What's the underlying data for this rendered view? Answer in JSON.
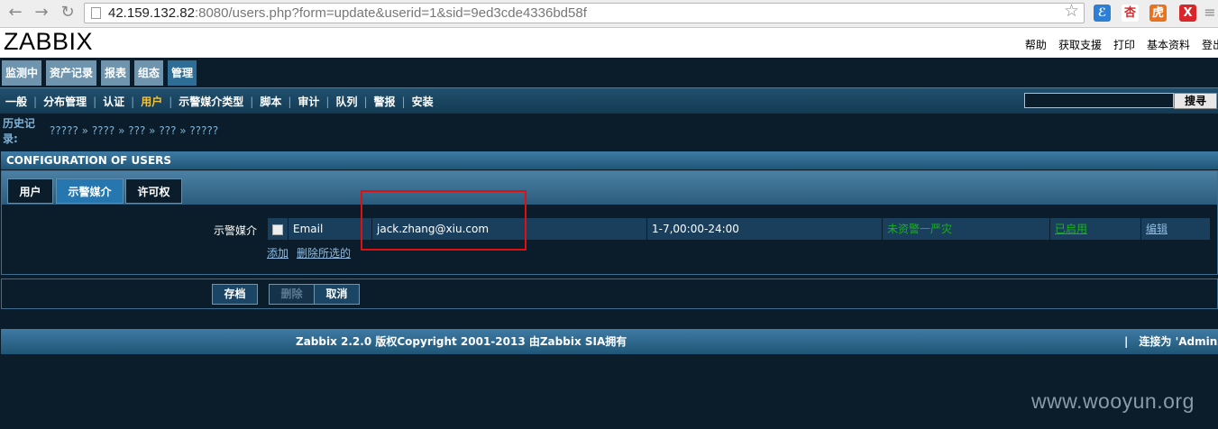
{
  "browser": {
    "url_host": "42.159.132.82",
    "url_rest": ":8080/users.php?form=update&userid=1&sid=9ed3cde4336bd58f",
    "ext_icons": [
      "ℰ",
      "杏",
      "虎",
      "X"
    ],
    "ext_colors": [
      "#2d7fd6",
      "#ffffff",
      "#e8731e",
      "#d8262a"
    ]
  },
  "header": {
    "logo": "ZABBIX",
    "links": [
      "帮助",
      "获取支援",
      "打印",
      "基本资料",
      "登出"
    ]
  },
  "main_menu": {
    "items": [
      "监测中",
      "资产记录",
      "报表",
      "组态",
      "管理"
    ],
    "active_index": 4
  },
  "sub_menu": {
    "items": [
      "一般",
      "分布管理",
      "认证",
      "用户",
      "示警媒介类型",
      "脚本",
      "审计",
      "队列",
      "警报",
      "安装"
    ],
    "active_index": 3,
    "search_button": "搜寻"
  },
  "history": {
    "label": "历史记录:",
    "path": "????? » ???? » ??? » ??? » ?????"
  },
  "config": {
    "title": "CONFIGURATION OF USERS",
    "tabs": [
      "用户",
      "示警媒介",
      "许可权"
    ],
    "active_tab": 1,
    "media_label": "示警媒介",
    "media_row": {
      "type": "Email",
      "send_to": "jack.zhang@xiu.com",
      "when_active": "1-7,00:00-24:00",
      "severity": "未资警一严灾",
      "status": "已启用",
      "action": "编辑"
    },
    "add_link": "添加",
    "delete_selected_link": "删除所选的"
  },
  "buttons": {
    "save": "存档",
    "delete": "删除",
    "cancel": "取消"
  },
  "footer": {
    "copyright": "Zabbix 2.2.0 版权Copyright 2001-2013 由Zabbix SIA拥有",
    "separator": "|",
    "connected": "连接为 'Admin'"
  },
  "watermark": "www.wooyun.org"
}
